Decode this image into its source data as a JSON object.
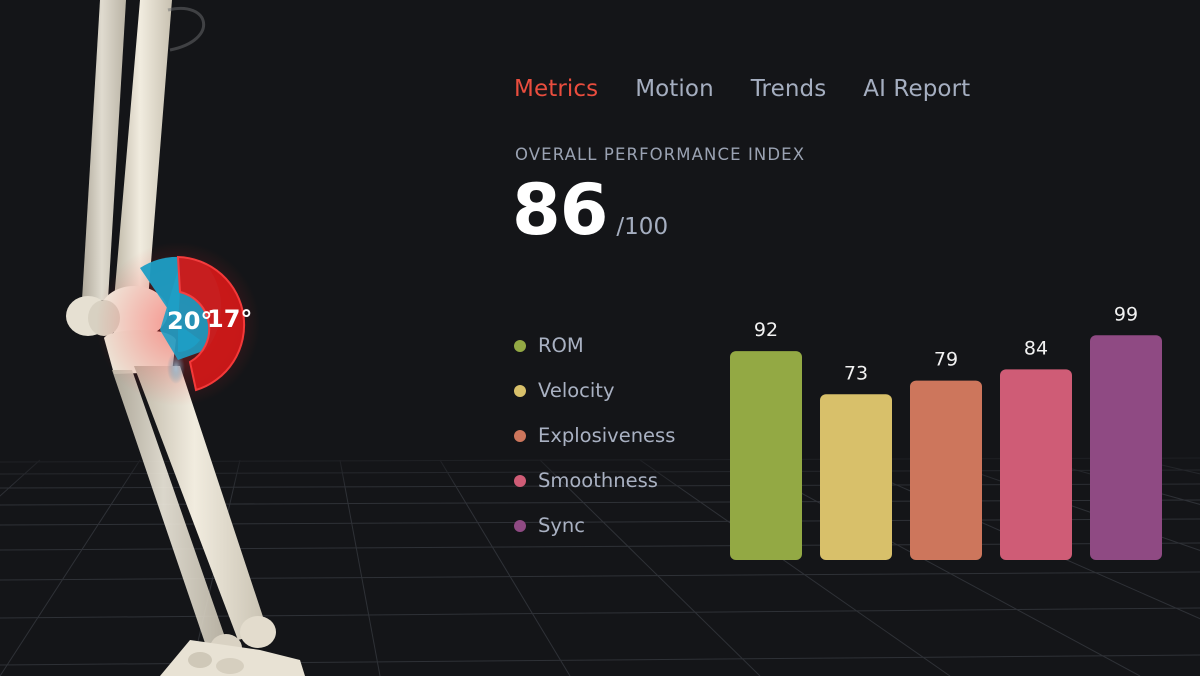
{
  "tabs": [
    {
      "label": "Metrics",
      "active": true
    },
    {
      "label": "Motion",
      "active": false
    },
    {
      "label": "Trends",
      "active": false
    },
    {
      "label": "AI Report",
      "active": false
    }
  ],
  "performance": {
    "label": "OVERALL PERFORMANCE INDEX",
    "score": "86",
    "max": "/100"
  },
  "joint_angles": {
    "left": "20°",
    "right": "17°"
  },
  "legend": [
    {
      "label": "ROM",
      "color": "#93a944"
    },
    {
      "label": "Velocity",
      "color": "#d8c06a"
    },
    {
      "label": "Explosiveness",
      "color": "#cd765c"
    },
    {
      "label": "Smoothness",
      "color": "#cf5c76"
    },
    {
      "label": "Sync",
      "color": "#8f4a83"
    }
  ],
  "chart_data": {
    "type": "bar",
    "categories": [
      "ROM",
      "Velocity",
      "Explosiveness",
      "Smoothness",
      "Sync"
    ],
    "values": [
      92,
      73,
      79,
      84,
      99
    ],
    "colors": [
      "#93a944",
      "#d8c06a",
      "#cd765c",
      "#cf5c76",
      "#8f4a83"
    ],
    "title": "",
    "xlabel": "",
    "ylabel": "",
    "grid": false
  },
  "colors": {
    "accent": "#ea4d3e",
    "background": "#141518",
    "angle_blue": "#1e9ec5",
    "angle_red": "#d01818"
  },
  "icons": {
    "model": "skeleton-leg-model"
  }
}
